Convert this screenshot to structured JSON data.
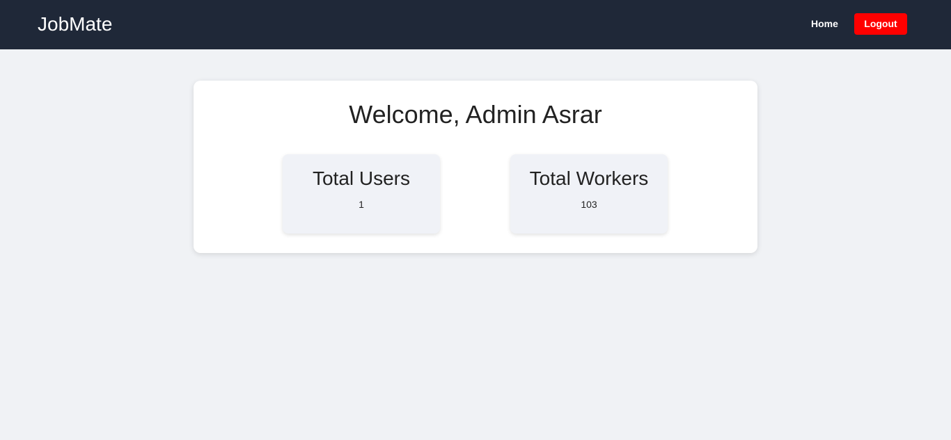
{
  "navbar": {
    "brand": "JobMate",
    "home_label": "Home",
    "logout_label": "Logout"
  },
  "dashboard": {
    "welcome": "Welcome, Admin Asrar",
    "stats": [
      {
        "title": "Total Users",
        "value": "1"
      },
      {
        "title": "Total Workers",
        "value": "103"
      }
    ]
  },
  "colors": {
    "navbar_bg": "#1f2838",
    "logout_bg": "#ff0000",
    "page_bg": "#f0f2f5",
    "card_bg": "#ffffff",
    "stat_card_bg": "#f0f2f7"
  }
}
